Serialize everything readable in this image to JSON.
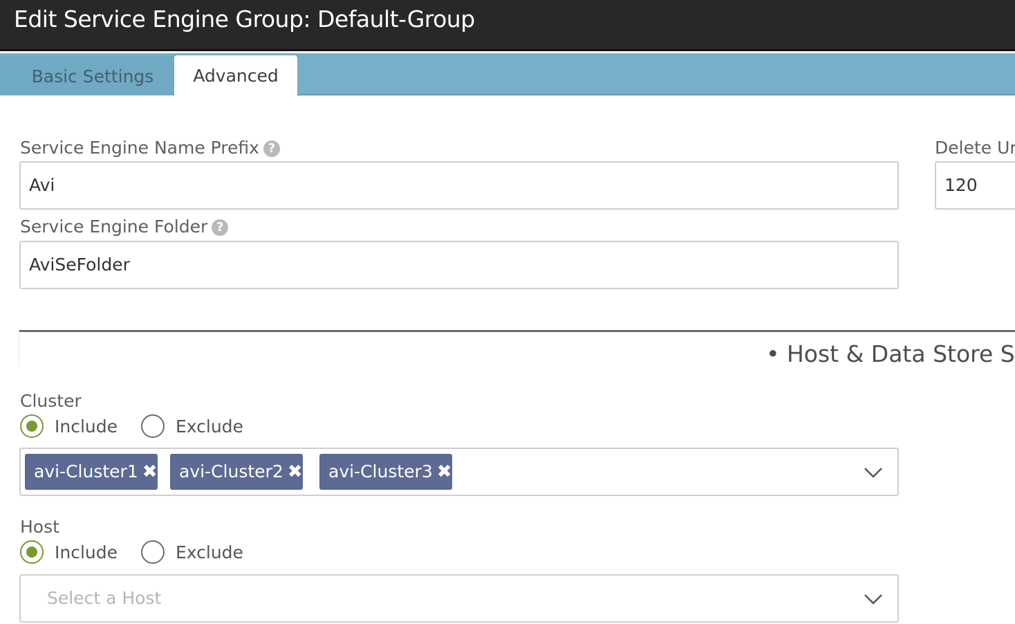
{
  "window": {
    "title": "Edit Service Engine Group: Default-Group"
  },
  "tabs": [
    {
      "label": "Basic Settings",
      "active": false
    },
    {
      "label": "Advanced",
      "active": true
    }
  ],
  "fields": {
    "name_prefix": {
      "label": "Service Engine Name Prefix",
      "value": "Avi"
    },
    "folder": {
      "label": "Service Engine Folder",
      "value": "AviSeFolder"
    },
    "delete_unused": {
      "label": "Delete Ur",
      "value": "120"
    }
  },
  "section": {
    "title": "• Host & Data Store Sco"
  },
  "cluster": {
    "label": "Cluster",
    "include_label": "Include",
    "exclude_label": "Exclude",
    "selected": "include",
    "chips": [
      "avi-Cluster1",
      "avi-Cluster2",
      "avi-Cluster3"
    ]
  },
  "host": {
    "label": "Host",
    "include_label": "Include",
    "exclude_label": "Exclude",
    "selected": "include",
    "placeholder": "Select a Host"
  },
  "colors": {
    "titlebar": "#28282b",
    "tabbar": "#77aec9",
    "chip": "#5d6a93",
    "radio_selected": "#7a9a30"
  },
  "icons": {
    "help": "question-circle-icon",
    "remove": "close-x-icon",
    "dropdown": "chevron-down-icon"
  }
}
